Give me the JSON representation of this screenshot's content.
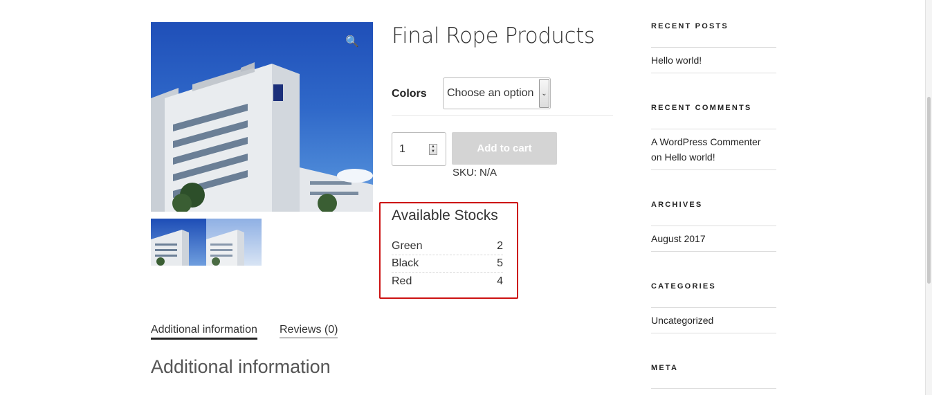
{
  "product": {
    "title": "Final Rope Products",
    "image_zoom_icon": "magnifier-icon",
    "variation": {
      "label": "Colors",
      "selected": "Choose an option"
    },
    "quantity": "1",
    "add_to_cart_label": "Add to cart",
    "sku_label": "SKU:",
    "sku_value": "N/A"
  },
  "stocks": {
    "title": "Available Stocks",
    "rows": [
      {
        "color": "Green",
        "count": "2"
      },
      {
        "color": "Black",
        "count": "5"
      },
      {
        "color": "Red",
        "count": "4"
      }
    ]
  },
  "tabs": [
    {
      "label": "Additional information",
      "active": true
    },
    {
      "label": "Reviews (0)",
      "active": false
    }
  ],
  "section_heading": "Additional information",
  "sidebar": {
    "recent_posts": {
      "title": "RECENT POSTS",
      "items": [
        "Hello world!"
      ]
    },
    "recent_comments": {
      "title": "RECENT COMMENTS",
      "author": "A WordPress Commenter",
      "on": "on",
      "post": "Hello world!"
    },
    "archives": {
      "title": "ARCHIVES",
      "items": [
        "August 2017"
      ]
    },
    "categories": {
      "title": "CATEGORIES",
      "items": [
        "Uncategorized"
      ]
    },
    "meta": {
      "title": "META"
    }
  },
  "colors": {
    "highlight_border": "#cc1111",
    "disabled_button": "#d4d4d4"
  }
}
